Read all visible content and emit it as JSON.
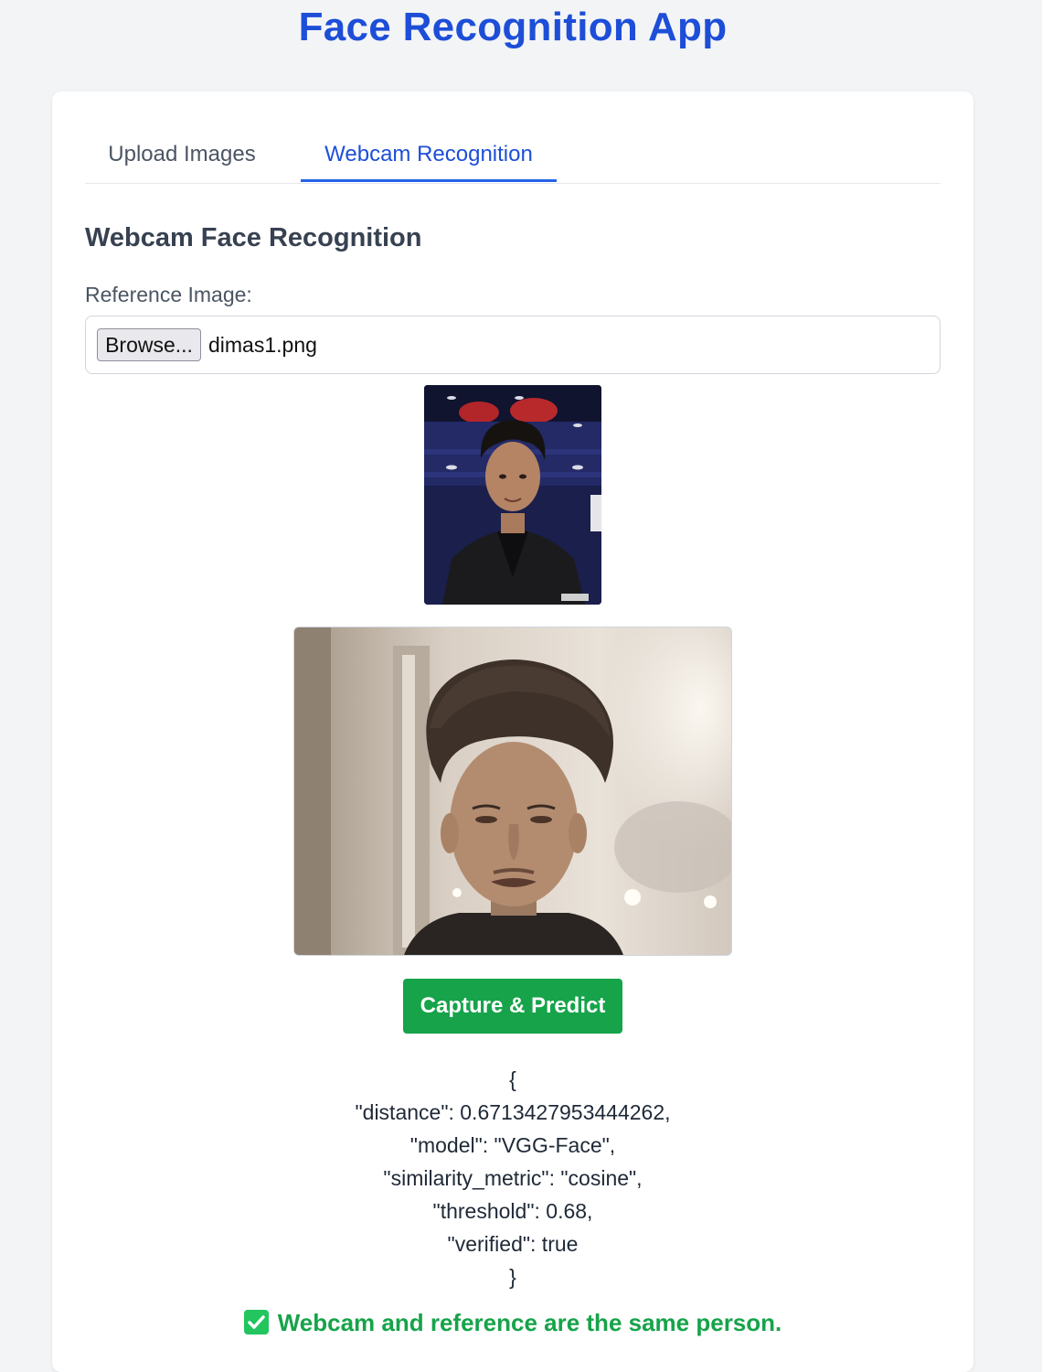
{
  "app": {
    "title": "Face Recognition App"
  },
  "tabs": [
    {
      "label": "Upload Images",
      "active": false
    },
    {
      "label": "Webcam Recognition",
      "active": true
    }
  ],
  "webcam_panel": {
    "title": "Webcam Face Recognition",
    "reference_label": "Reference Image:",
    "browse_label": "Browse...",
    "file_name": "dimas1.png",
    "capture_button": "Capture & Predict"
  },
  "result": {
    "lines": [
      "{",
      "\"distance\": 0.6713427953444262,",
      "\"model\": \"VGG-Face\",",
      "\"similarity_metric\": \"cosine\",",
      "\"threshold\": 0.68,",
      "\"verified\": true",
      "}"
    ],
    "verdict": "Webcam and reference are the same person."
  },
  "colors": {
    "accent": "#1d4ed8",
    "success": "#16a34a",
    "page_background": "#f3f4f6"
  },
  "icons": {
    "verdict_icon": "check-mark-button-icon"
  }
}
